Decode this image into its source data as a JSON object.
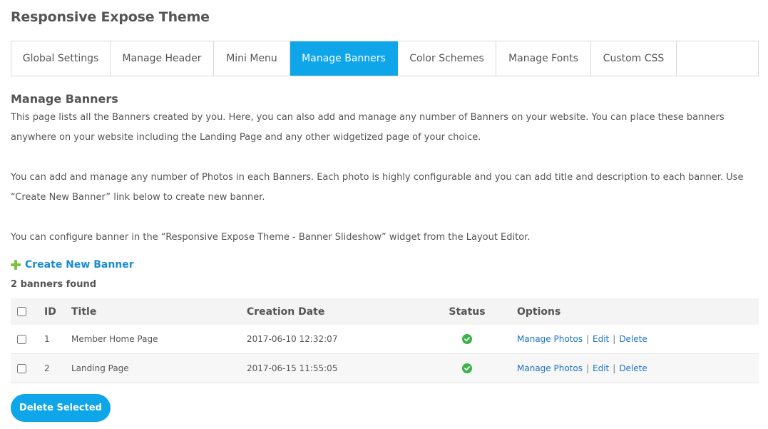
{
  "page": {
    "title": "Responsive Expose Theme"
  },
  "tabs": [
    {
      "label": "Global Settings",
      "active": false
    },
    {
      "label": "Manage Header",
      "active": false
    },
    {
      "label": "Mini Menu",
      "active": false
    },
    {
      "label": "Manage Banners",
      "active": true
    },
    {
      "label": "Color Schemes",
      "active": false
    },
    {
      "label": "Manage Fonts",
      "active": false
    },
    {
      "label": "Custom CSS",
      "active": false
    }
  ],
  "section": {
    "heading": "Manage Banners",
    "paragraph1": "This page lists all the Banners created by you. Here, you can also add and manage any number of Banners on your website. You can place these banners anywhere on your website including the Landing Page and any other widgetized page of your choice.",
    "paragraph2": "You can add and manage any number of Photos in each Banners. Each photo is highly configurable and you can add title and description to each banner. Use “Create New Banner” link below to create new banner.",
    "paragraph3": "You can configure banner in the “Responsive Expose Theme - Banner Slideshow” widget from the Layout Editor."
  },
  "actions": {
    "create_label": "Create New Banner",
    "count_text": "2 banners found",
    "delete_selected_label": "Delete Selected"
  },
  "table": {
    "headers": {
      "id": "ID",
      "title": "Title",
      "date": "Creation Date",
      "status": "Status",
      "options": "Options"
    },
    "rows": [
      {
        "id": "1",
        "title": "Member Home Page",
        "date": "2017-06-10 12:32:07",
        "status": "enabled",
        "manage": "Manage Photos",
        "edit": "Edit",
        "delete": "Delete"
      },
      {
        "id": "2",
        "title": "Landing Page",
        "date": "2017-06-15 11:55:05",
        "status": "enabled",
        "manage": "Manage Photos",
        "edit": "Edit",
        "delete": "Delete"
      }
    ],
    "separator": "|"
  },
  "colors": {
    "accent": "#0ea5e9",
    "link": "#1a73c7",
    "status_ok": "#3cb24a",
    "plus": "#7dc242"
  }
}
